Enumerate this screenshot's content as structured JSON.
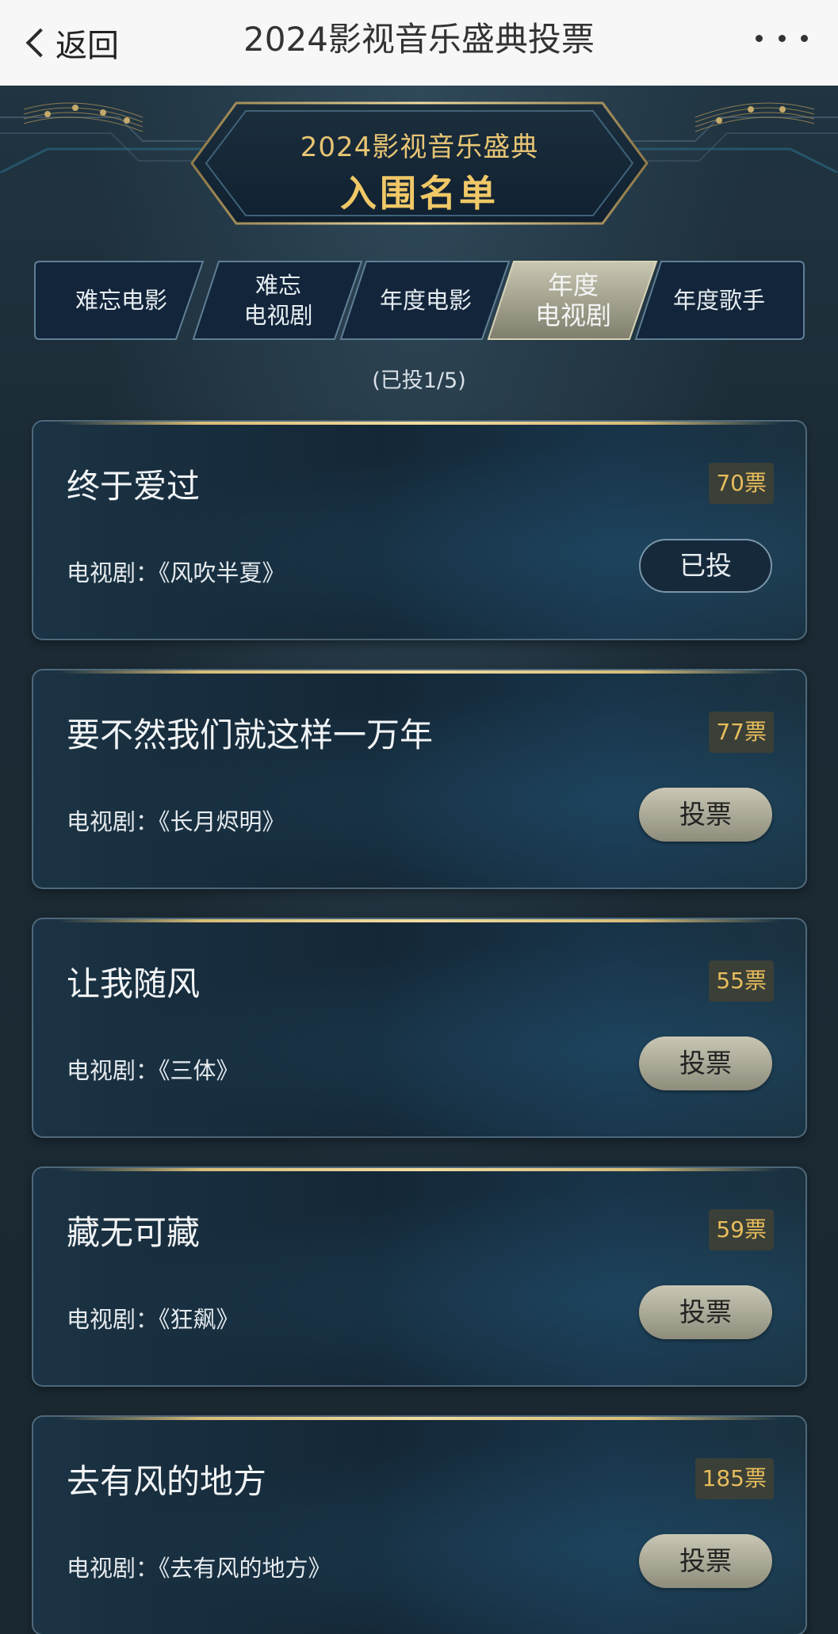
{
  "nav": {
    "back_label": "返回",
    "title": "2024影视音乐盛典投票"
  },
  "banner": {
    "line1": "2024影视音乐盛典",
    "line2": "入围名单"
  },
  "tabs": [
    {
      "label": "难忘电影",
      "active": false
    },
    {
      "label": "难忘\n电视剧",
      "active": false
    },
    {
      "label": "年度电影",
      "active": false
    },
    {
      "label": "年度\n电视剧",
      "active": true
    },
    {
      "label": "年度歌手",
      "active": false
    }
  ],
  "progress_text": "(已投1/5)",
  "candidates": [
    {
      "song": "终于爱过",
      "votes": "70票",
      "work": "电视剧：《风吹半夏》",
      "button": "已投",
      "voted": true
    },
    {
      "song": "要不然我们就这样一万年",
      "votes": "77票",
      "work": "电视剧：《长月烬明》",
      "button": "投票",
      "voted": false
    },
    {
      "song": "让我随风",
      "votes": "55票",
      "work": "电视剧：《三体》",
      "button": "投票",
      "voted": false
    },
    {
      "song": "藏无可藏",
      "votes": "59票",
      "work": "电视剧：《狂飙》",
      "button": "投票",
      "voted": false
    },
    {
      "song": "去有风的地方",
      "votes": "185票",
      "work": "电视剧：《去有风的地方》",
      "button": "投票",
      "voted": false
    }
  ],
  "colors": {
    "gold": "#e8c574",
    "vote_count": "#e8bd5c",
    "background": "#1b2a34"
  }
}
